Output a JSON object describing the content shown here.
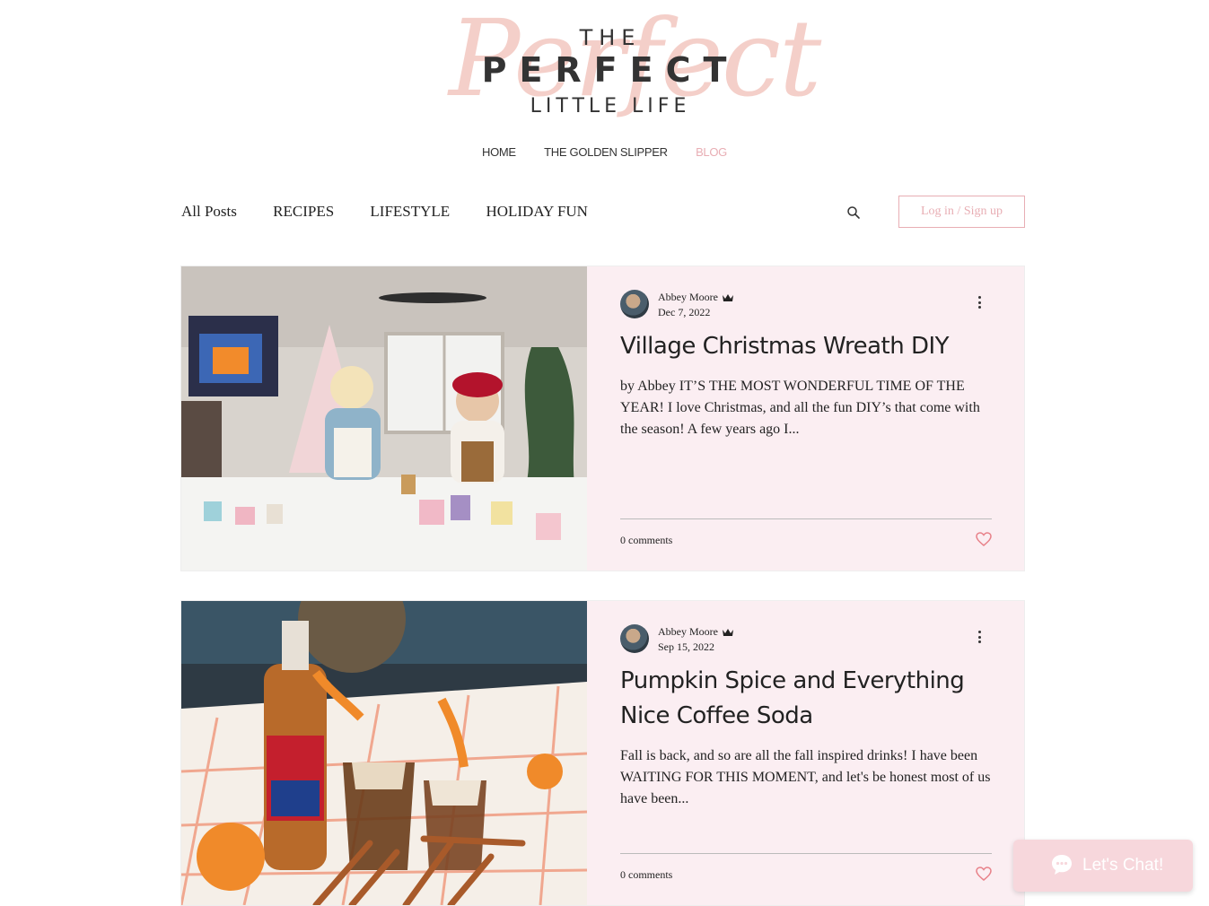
{
  "logo": {
    "script": "Perfect",
    "the": "THE",
    "perfect": "PERFECT",
    "little_life": "LITTLE LIFE"
  },
  "main_nav": {
    "items": [
      "HOME",
      "THE GOLDEN SLIPPER",
      "BLOG"
    ],
    "active": "BLOG"
  },
  "category_nav": {
    "items": [
      "All Posts",
      "RECIPES",
      "LIFESTYLE",
      "HOLIDAY FUN"
    ]
  },
  "login_label": "Log in / Sign up",
  "posts": [
    {
      "author": "Abbey Moore",
      "date": "Dec 7, 2022",
      "title": "Village Christmas Wreath DIY",
      "excerpt": "by Abbey IT’S THE MOST WONDERFUL TIME OF THE YEAR! I love Christmas, and all the fun DIY’s that come with the season! A few years ago I...",
      "comments": "0 comments"
    },
    {
      "author": "Abbey Moore",
      "date": "Sep 15, 2022",
      "title": "Pumpkin Spice and Everything Nice Coffee Soda",
      "excerpt": "Fall is back, and so are all the fall inspired drinks! I have been WAITING FOR THIS MOMENT, and let's be honest most of us have been...",
      "comments": "0 comments"
    }
  ],
  "chat": {
    "label": "Let's Chat!"
  },
  "colors": {
    "accent_pink": "#e8aeb4",
    "card_bg": "#fbeef2",
    "heart": "#e8828a",
    "chat_bg": "#f7d7dc"
  },
  "icons": [
    "search-icon",
    "crown-icon",
    "more-options-icon",
    "heart-icon",
    "chat-bubble-icon"
  ]
}
